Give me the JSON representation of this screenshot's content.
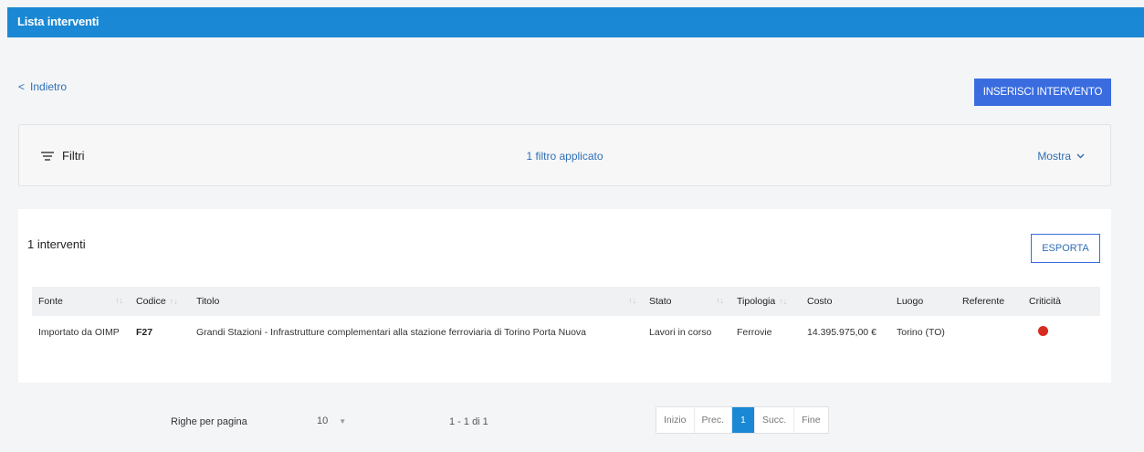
{
  "header": {
    "title": "Lista interventi"
  },
  "nav": {
    "back_label": "Indietro",
    "back_icon": "chevron-left-icon"
  },
  "actions": {
    "insert_label": "INSERISCI INTERVENTO",
    "export_label": "ESPORTA"
  },
  "filters": {
    "label": "Filtri",
    "applied": "1 filtro applicato",
    "toggle_label": "Mostra"
  },
  "results": {
    "count_label": "1 interventi"
  },
  "table": {
    "columns": [
      "Fonte",
      "Codice",
      "Titolo",
      "Stato",
      "Tipologia",
      "Costo",
      "Luogo",
      "Referente",
      "Criticità"
    ],
    "rows": [
      {
        "fonte": "Importato da OIMP",
        "codice": "F27",
        "titolo": "Grandi Stazioni - Infrastrutture complementari alla stazione ferroviaria di Torino Porta Nuova",
        "stato": "Lavori in corso",
        "tipologia": "Ferrovie",
        "costo": "14.395.975,00 €",
        "luogo": "Torino (TO)",
        "referente": "",
        "criticita_color": "#d62b1f"
      }
    ]
  },
  "pagination": {
    "rows_per_page_label": "Righe per pagina",
    "rows_per_page_value": "10",
    "range": "1 - 1 di 1",
    "first": "Inizio",
    "prev": "Prec.",
    "current": "1",
    "next": "Succ.",
    "last": "Fine"
  },
  "colors": {
    "header_bar": "#1a88d4",
    "primary_button": "#3a6ce0",
    "link": "#2f6fb5"
  }
}
